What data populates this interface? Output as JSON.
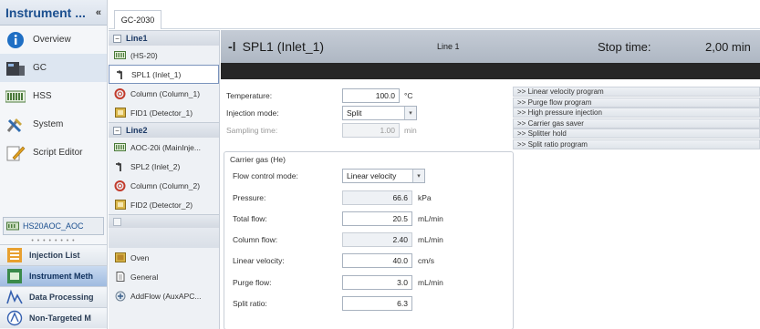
{
  "nav": {
    "title": "Instrument ...",
    "collapse": "«",
    "items": [
      {
        "label": "Overview",
        "icon": "info-icon"
      },
      {
        "label": "GC",
        "icon": "gc-instrument-icon"
      },
      {
        "label": "HSS",
        "icon": "headspace-sampler-icon"
      },
      {
        "label": "System",
        "icon": "system-tools-icon"
      },
      {
        "label": "Script Editor",
        "icon": "script-editor-icon"
      }
    ],
    "config_label": "HS20AOC_AOC",
    "bottom_items": [
      {
        "label": "Injection List",
        "icon": "injection-list-icon"
      },
      {
        "label": "Instrument Meth",
        "icon": "instrument-method-icon"
      },
      {
        "label": "Data Processing",
        "icon": "data-processing-icon"
      },
      {
        "label": "Non-Targeted M",
        "icon": "non-targeted-icon"
      }
    ]
  },
  "document_tab": "GC-2030",
  "tree": {
    "line1": {
      "label": "Line1",
      "items": [
        {
          "label": "(HS-20)",
          "icon": "sampler-icon"
        },
        {
          "label": "SPL1 (Inlet_1)",
          "icon": "inlet-icon"
        },
        {
          "label": "Column (Column_1)",
          "icon": "column-icon"
        },
        {
          "label": "FID1 (Detector_1)",
          "icon": "detector-icon"
        }
      ]
    },
    "line2": {
      "label": "Line2",
      "items": [
        {
          "label": "AOC-20i (MainInje...",
          "icon": "autoinjector-icon"
        },
        {
          "label": "SPL2 (Inlet_2)",
          "icon": "inlet-icon"
        },
        {
          "label": "Column (Column_2)",
          "icon": "column-icon"
        },
        {
          "label": "FID2 (Detector_2)",
          "icon": "detector-icon"
        }
      ]
    },
    "other_items": [
      {
        "label": "Oven",
        "icon": "oven-icon"
      },
      {
        "label": "General",
        "icon": "general-icon"
      },
      {
        "label": "AddFlow (AuxAPC...",
        "icon": "addflow-icon"
      }
    ]
  },
  "header": {
    "title": "SPL1 (Inlet_1)",
    "line": "Line 1",
    "stop_time_label": "Stop time:",
    "stop_time_value": "2,00 min"
  },
  "form": {
    "temperature": {
      "label": "Temperature:",
      "value": "100.0",
      "unit": "°C"
    },
    "injection_mode": {
      "label": "Injection mode:",
      "value": "Split"
    },
    "sampling_time": {
      "label": "Sampling time:",
      "value": "1.00",
      "unit": "min"
    }
  },
  "carrier": {
    "title": "Carrier gas (He)",
    "flow_control_mode": {
      "label": "Flow control mode:",
      "value": "Linear velocity"
    },
    "pressure": {
      "label": "Pressure:",
      "value": "66.6",
      "unit": "kPa"
    },
    "total_flow": {
      "label": "Total flow:",
      "value": "20.5",
      "unit": "mL/min"
    },
    "column_flow": {
      "label": "Column flow:",
      "value": "2.40",
      "unit": "mL/min"
    },
    "linear_velocity": {
      "label": "Linear velocity:",
      "value": "40.0",
      "unit": "cm/s"
    },
    "purge_flow": {
      "label": "Purge flow:",
      "value": "3.0",
      "unit": "mL/min"
    },
    "split_ratio": {
      "label": "Split ratio:",
      "value": "6.3"
    }
  },
  "links": [
    ">> Linear velocity program",
    ">> Purge flow program",
    ">> High pressure injection",
    ">> Carrier gas saver",
    ">> Splitter hold",
    ">> Split ratio program"
  ]
}
